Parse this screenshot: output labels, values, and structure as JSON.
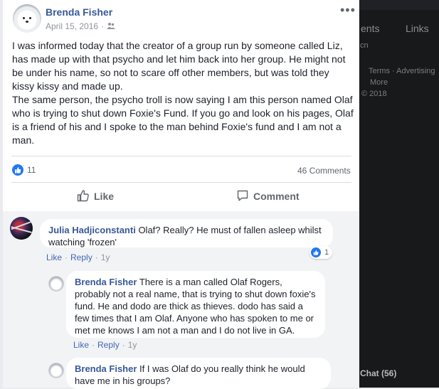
{
  "post": {
    "author": "Brenda Fisher",
    "date": "April 15, 2016",
    "more_label": "•••",
    "paragraph_1": "I was informed today that the creator of a group run by someone called Liz, has made up with that psycho and let him back into her group. He might not be under his name, so not to scare off other members, but was told they kissy kissy and made up.",
    "paragraph_2": "The same person, the psycho troll is now saying I am this person named Olaf who is trying to shut down Foxie's Fund. If you go and look on his pages, Olaf is a friend of his and I spoke to the man behind Foxie's fund and I am not a man.",
    "like_count": "11",
    "comment_count": "46 Comments",
    "like_label": "Like",
    "comment_label": "Comment"
  },
  "comments": [
    {
      "author": "Julia Hadjiconstanti",
      "text": "Olaf? Really? He must of fallen asleep whilst watching 'frozen'",
      "like_label": "Like",
      "reply_label": "Reply",
      "time": "1y",
      "reaction_count": "1"
    },
    {
      "author": "Brenda Fisher",
      "text": "There is a man called Olaf Rogers, probably not a real name, that is trying to shut down foxie's fund. He and dodo are thick as thieves. dodo has said a few times that I am Olaf. Anyone who has spoken to me or met me knows I am not a man and I do not live in GA.",
      "like_label": "Like",
      "reply_label": "Reply",
      "time": "1y"
    },
    {
      "author": "Brenda Fisher",
      "text": "If I was Olaf do you really think he would have me in his groups?"
    }
  ],
  "background_page": {
    "tab_events": "ents",
    "tab_links": "Links",
    "line_1": "cn",
    "line_2": "Terms · Advertising",
    "line_3": "More",
    "line_4": "© 2018",
    "chat": "Chat (56)"
  },
  "colors": {
    "link_blue": "#385898",
    "action_blue": "#4267b2",
    "like_blue": "#2078f4"
  }
}
